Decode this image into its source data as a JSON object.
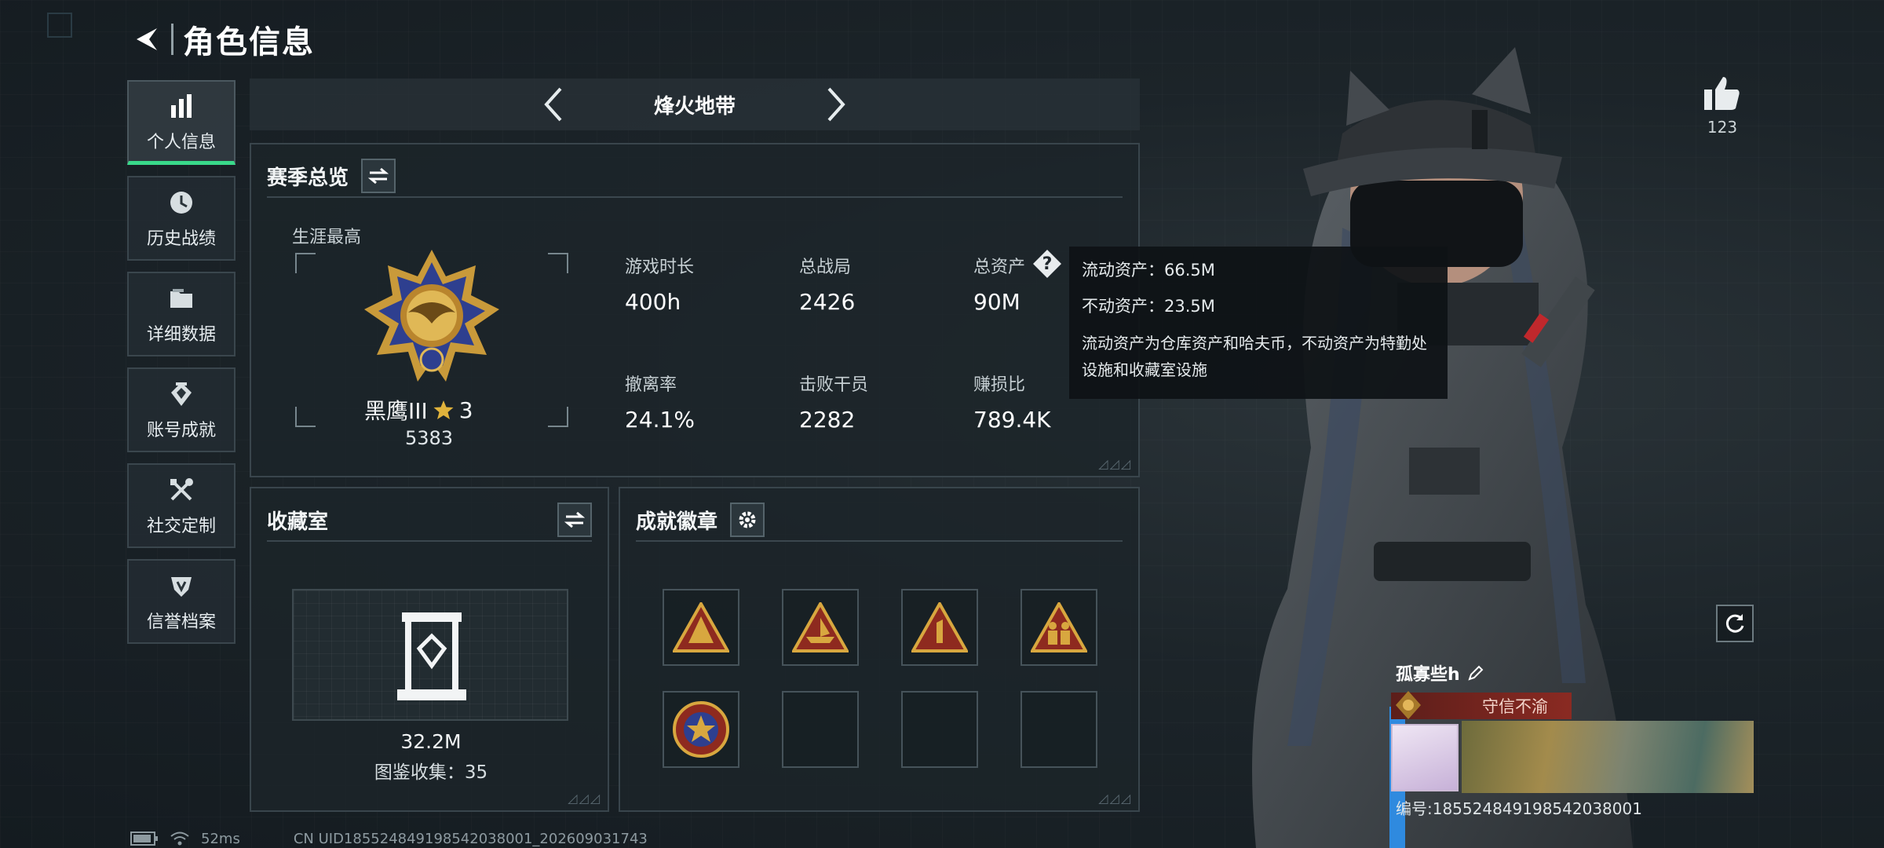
{
  "header": {
    "title": "角色信息"
  },
  "sidebar": {
    "items": [
      {
        "label": "个人信息",
        "icon": "bar-chart-icon",
        "active": true
      },
      {
        "label": "历史战绩",
        "icon": "clock-icon"
      },
      {
        "label": "详细数据",
        "icon": "folder-icon"
      },
      {
        "label": "账号成就",
        "icon": "achievement-icon"
      },
      {
        "label": "社交定制",
        "icon": "tools-icon"
      },
      {
        "label": "信誉档案",
        "icon": "shield-icon"
      }
    ]
  },
  "mode": {
    "name": "烽火地带"
  },
  "season": {
    "title": "赛季总览",
    "career_label": "生涯最高",
    "rank_name": "黑鹰III",
    "rank_stars": "3",
    "rank_score": "5383",
    "stats": {
      "play_time": {
        "label": "游戏时长",
        "value": "400h"
      },
      "total_matches": {
        "label": "总战局",
        "value": "2426"
      },
      "total_assets": {
        "label": "总资产",
        "value": "90M"
      },
      "extract_rate": {
        "label": "撤离率",
        "value": "24.1%"
      },
      "kills": {
        "label": "击败干员",
        "value": "2282"
      },
      "profit_ratio": {
        "label": "赚损比",
        "value": "789.4K"
      }
    }
  },
  "tooltip": {
    "liquid": "流动资产：66.5M",
    "fixed": "不动资产：23.5M",
    "note": "流动资产为仓库资产和哈夫币，不动资产为特勤处设施和收藏室设施"
  },
  "collection": {
    "title": "收藏室",
    "value": "32.2M",
    "sub": "图鉴收集：35"
  },
  "badges": {
    "title": "成就徽章"
  },
  "like": {
    "count": "123"
  },
  "card": {
    "name": "孤寡些h",
    "tag": "守信不渝",
    "uid": "编号:18552484919854203800​1"
  },
  "status": {
    "ping": "52ms",
    "build": "CN UID18552484919854203800​1_202609031743"
  },
  "colors": {
    "accent_green": "#39d98a",
    "gold": "#e0b33c",
    "tag_red": "#8a2a22"
  }
}
